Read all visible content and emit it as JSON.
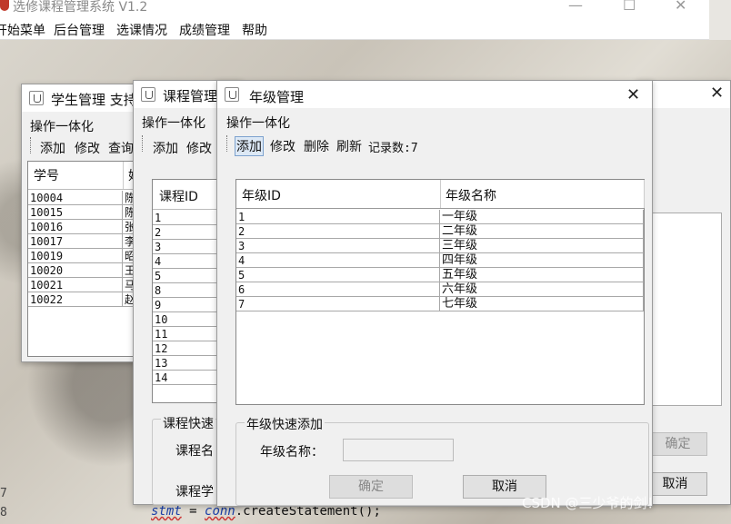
{
  "app": {
    "title": "选修课程管理系统 V1.2",
    "minimize": "—",
    "maximize": "☐",
    "close": "✕"
  },
  "menu": [
    "开始菜单",
    "后台管理",
    "选课情况",
    "成绩管理",
    "帮助"
  ],
  "student_win": {
    "title": "学生管理 支持",
    "group": "操作一体化",
    "tools": [
      "添加",
      "修改",
      "查询"
    ],
    "headers": [
      "学号",
      "姓"
    ],
    "rows": [
      [
        "10004",
        "陈"
      ],
      [
        "10015",
        "陈"
      ],
      [
        "10016",
        "张"
      ],
      [
        "10017",
        "李"
      ],
      [
        "10019",
        "昭"
      ],
      [
        "10020",
        "王"
      ],
      [
        "10021",
        "马"
      ],
      [
        "10022",
        "赵"
      ]
    ]
  },
  "course_win": {
    "title": "课程管理",
    "group": "操作一体化",
    "tools": [
      "添加",
      "修改"
    ],
    "headers": [
      "课程ID"
    ],
    "rows": [
      "1",
      "2",
      "3",
      "4",
      "5",
      "8",
      "9",
      "10",
      "11",
      "12",
      "13",
      "14"
    ],
    "quick_group": "课程快速",
    "labels": [
      "课程名",
      "课程学"
    ]
  },
  "right_win": {
    "close": "✕",
    "btn_confirm": "确定",
    "btn_cancel": "取消"
  },
  "grade_win": {
    "title": "年级管理",
    "close": "✕",
    "group": "操作一体化",
    "tools": {
      "add": "添加",
      "edit": "修改",
      "delete": "删除",
      "refresh": "刷新",
      "count": "记录数:7"
    },
    "headers": [
      "年级ID",
      "年级名称"
    ],
    "rows": [
      [
        "1",
        "一年级"
      ],
      [
        "2",
        "二年级"
      ],
      [
        "3",
        "三年级"
      ],
      [
        "4",
        "四年级"
      ],
      [
        "5",
        "五年级"
      ],
      [
        "6",
        "六年级"
      ],
      [
        "7",
        "七年级"
      ]
    ],
    "quick_group": "年级快速添加",
    "name_label": "年级名称：",
    "name_value": "",
    "btn_confirm": "确定",
    "btn_cancel": "取消"
  },
  "code": {
    "line_numbers": [
      "7",
      "8"
    ],
    "text_stmt": "stmt",
    "text_eq": " = ",
    "text_conn": "conn",
    "text_rest": ".createStatement();"
  },
  "watermark": "CSDN @三少爷的剑！"
}
